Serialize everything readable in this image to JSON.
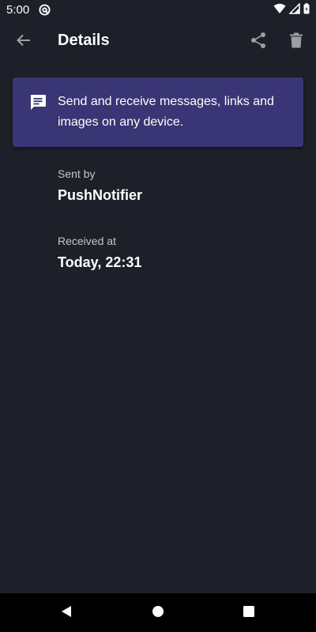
{
  "status_bar": {
    "time": "5:00",
    "icons": [
      "at-sign-icon",
      "wifi-icon",
      "signal-icon",
      "battery-icon"
    ]
  },
  "app_bar": {
    "title": "Details",
    "back_icon": "arrow-back-icon",
    "actions": [
      "share-icon",
      "delete-icon"
    ]
  },
  "message": {
    "icon": "message-icon",
    "text": "Send and receive messages, links and images on any device.",
    "card_color": "#3a3574"
  },
  "details": {
    "sent_by": {
      "label": "Sent by",
      "value": "PushNotifier"
    },
    "received_at": {
      "label": "Received at",
      "value": "Today, 22:31"
    }
  },
  "nav_bar": {
    "buttons": [
      "nav-back-icon",
      "nav-home-icon",
      "nav-recents-icon"
    ]
  },
  "colors": {
    "background": "#1d2028",
    "accent_card": "#3a3574",
    "icon_gray": "#9aa0a6",
    "label_gray": "#c4c6cc"
  }
}
